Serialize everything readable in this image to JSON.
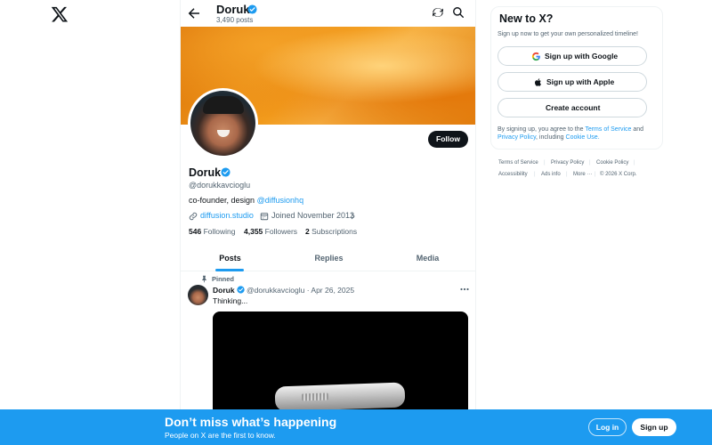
{
  "header": {
    "name": "Doruk",
    "posts_count": "3,490 posts"
  },
  "profile": {
    "name": "Doruk",
    "handle": "@dorukkavcioglu",
    "bio_text": "co-founder, design ",
    "bio_mention": "@diffusionhq",
    "website": "diffusion.studio",
    "joined": "Joined November 2012",
    "following_count": "546",
    "following_label": "Following",
    "followers_count": "4,355",
    "followers_label": "Followers",
    "subscriptions_count": "2",
    "subscriptions_label": "Subscriptions",
    "follow_label": "Follow"
  },
  "tabs": [
    {
      "label": "Posts",
      "active": true
    },
    {
      "label": "Replies",
      "active": false
    },
    {
      "label": "Media",
      "active": false
    }
  ],
  "post": {
    "pinned_label": "Pinned",
    "author": "Doruk",
    "meta": "@dorukkavcioglu · Apr 26, 2025",
    "text": "Thinking..."
  },
  "signup_card": {
    "title": "New to X?",
    "subtitle": "Sign up now to get your own personalized timeline!",
    "google_label": "Sign up with Google",
    "apple_label": "Sign up with Apple",
    "create_label": "Create account",
    "terms_prefix": "By signing up, you agree to the ",
    "terms_link": "Terms of Service",
    "terms_and": " and ",
    "privacy_link": "Privacy Policy",
    "terms_including": ", including ",
    "cookie_link": "Cookie Use."
  },
  "footer": {
    "terms": "Terms of Service",
    "privacy": "Privacy Policy",
    "cookie": "Cookie Policy",
    "accessibility": "Accessibility",
    "ads": "Ads info",
    "more": "More ···",
    "copyright": "© 2026 X Corp."
  },
  "bottom_bar": {
    "title": "Don’t miss what’s happening",
    "subtitle": "People on X are the first to know.",
    "login_label": "Log in",
    "signup_label": "Sign up"
  },
  "colors": {
    "accent": "#1d9bf0",
    "text": "#0f1419",
    "muted": "#536471",
    "banner": "#f29b1c"
  },
  "icons": [
    "x-logo-icon",
    "back-arrow-icon",
    "verified-icon",
    "refresh-icon",
    "search-icon",
    "link-icon",
    "calendar-icon",
    "chevron-right-icon",
    "pin-icon",
    "more-icon",
    "google-icon",
    "apple-icon"
  ]
}
